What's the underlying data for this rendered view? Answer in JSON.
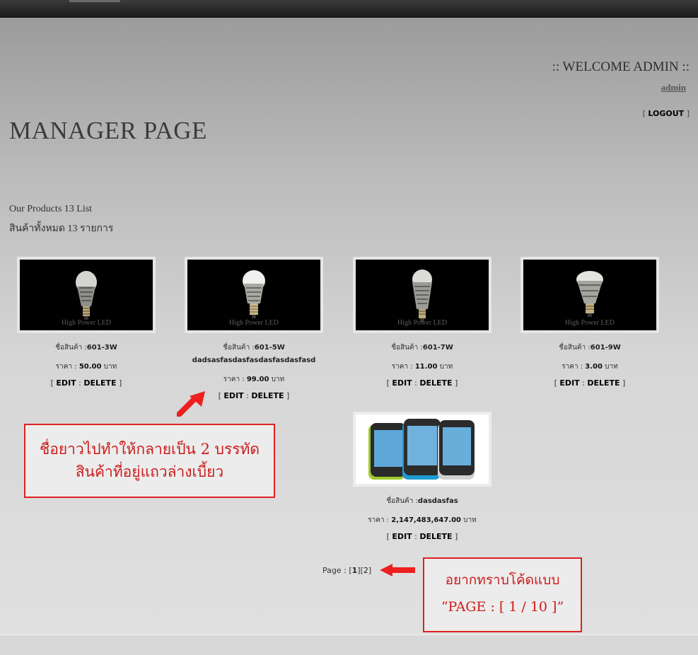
{
  "header": {
    "welcome": ":: WELCOME ADMIN ::",
    "user_link": "admin",
    "logout": "LOGOUT"
  },
  "page": {
    "title": "MANAGER PAGE",
    "count_en": "Our Products 13 List",
    "count_th": "สินค้าทั้งหมด 13 รายการ"
  },
  "labels": {
    "name_prefix": "ชื่อสินค้า :",
    "price_prefix": "ราคา : ",
    "currency": " บาท",
    "edit": "EDIT",
    "delete": "DELETE",
    "image_caption": "High Power LED"
  },
  "products": [
    {
      "name": "601-3W",
      "price": "50.00"
    },
    {
      "name": "601-5W dadsasfasdasfasdasfasdasfasd",
      "price": "99.00"
    },
    {
      "name": "601-7W",
      "price": "11.00"
    },
    {
      "name": "601-9W",
      "price": "3.00"
    },
    {
      "name": "dasdasfas",
      "price": "2,147,483,647.00"
    }
  ],
  "pagination": {
    "label": "Page : ",
    "pages": [
      "1",
      "2"
    ],
    "current": "1"
  },
  "annotations": {
    "note1": [
      "ชื่อยาวไปทำให้กลายเป็น 2 บรรทัด",
      "สินค้าที่อยู่แถวล่างเบี้ยว"
    ],
    "note2": [
      "อยากทราบโค้ดแบบ",
      "“PAGE : [ 1 / 10 ]”"
    ]
  },
  "colors": {
    "annotation_red": "#e02020",
    "top_bar": "#2a2a2a"
  }
}
